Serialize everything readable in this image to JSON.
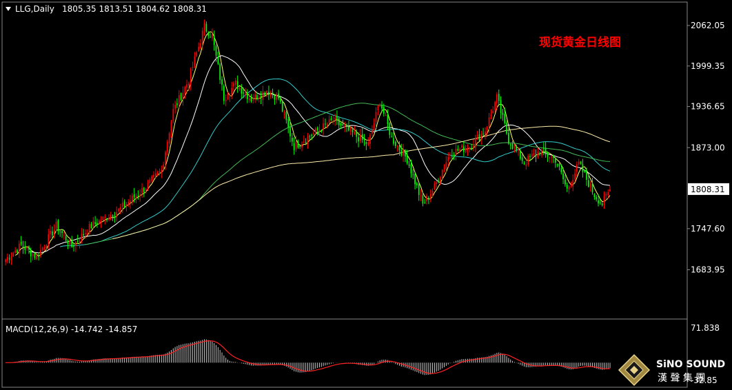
{
  "header": {
    "menu_icon": "triangle-down-icon",
    "symbol": "LLG,Daily",
    "ohlc": "1805.35 1813.51 1804.62 1808.31"
  },
  "overlay_title": "现货黄金日线图",
  "price_axis": {
    "ticks": [
      "2062.05",
      "1999.35",
      "1936.65",
      "1873.00",
      "1808.31",
      "1747.60",
      "1683.95"
    ],
    "current_price": "1808.31",
    "current_price_badge_color": "#ffffff"
  },
  "macd_panel": {
    "label": "MACD(12,26,9) -14.742 -14.857",
    "ticks": [
      "71.838",
      "-32.85"
    ]
  },
  "logo": {
    "text": "SiNO SOUND",
    "subtext": "漢 聲 集 團"
  },
  "colors": {
    "background": "#000000",
    "bull": "#ff0000",
    "bear": "#00ff00",
    "ma_yellow": "#ffff66",
    "ma_white": "#ffffff",
    "ma_cyan": "#33cccc",
    "ma_green": "#44bb55",
    "ma_cream": "#ffeeaa",
    "macd_hist": "#cccccc",
    "macd_signal": "#ff2222",
    "title_red": "#ff0000"
  },
  "chart_data": {
    "type": "candlestick",
    "symbol": "LLG",
    "timeframe": "Daily",
    "last_bar": {
      "open": 1805.35,
      "high": 1813.51,
      "low": 1804.62,
      "close": 1808.31
    },
    "ylim": [
      1660,
      2075
    ],
    "anchors": [
      {
        "i": 0,
        "p": 1700
      },
      {
        "i": 8,
        "p": 1722
      },
      {
        "i": 16,
        "p": 1704
      },
      {
        "i": 26,
        "p": 1752
      },
      {
        "i": 34,
        "p": 1720
      },
      {
        "i": 44,
        "p": 1752
      },
      {
        "i": 58,
        "p": 1776
      },
      {
        "i": 72,
        "p": 1812
      },
      {
        "i": 80,
        "p": 1838
      },
      {
        "i": 86,
        "p": 1930
      },
      {
        "i": 94,
        "p": 1978
      },
      {
        "i": 102,
        "p": 2060
      },
      {
        "i": 106,
        "p": 2045
      },
      {
        "i": 112,
        "p": 1950
      },
      {
        "i": 118,
        "p": 1972
      },
      {
        "i": 126,
        "p": 1948
      },
      {
        "i": 134,
        "p": 1962
      },
      {
        "i": 140,
        "p": 1950
      },
      {
        "i": 148,
        "p": 1875
      },
      {
        "i": 158,
        "p": 1895
      },
      {
        "i": 168,
        "p": 1915
      },
      {
        "i": 178,
        "p": 1895
      },
      {
        "i": 186,
        "p": 1878
      },
      {
        "i": 192,
        "p": 1945
      },
      {
        "i": 198,
        "p": 1888
      },
      {
        "i": 206,
        "p": 1855
      },
      {
        "i": 214,
        "p": 1785
      },
      {
        "i": 220,
        "p": 1812
      },
      {
        "i": 228,
        "p": 1865
      },
      {
        "i": 238,
        "p": 1875
      },
      {
        "i": 246,
        "p": 1900
      },
      {
        "i": 252,
        "p": 1950
      },
      {
        "i": 258,
        "p": 1885
      },
      {
        "i": 266,
        "p": 1850
      },
      {
        "i": 274,
        "p": 1868
      },
      {
        "i": 282,
        "p": 1855
      },
      {
        "i": 288,
        "p": 1808
      },
      {
        "i": 294,
        "p": 1848
      },
      {
        "i": 302,
        "p": 1800
      },
      {
        "i": 306,
        "p": 1786
      },
      {
        "i": 310,
        "p": 1808
      }
    ],
    "macd_ylim": [
      -40,
      80
    ]
  }
}
